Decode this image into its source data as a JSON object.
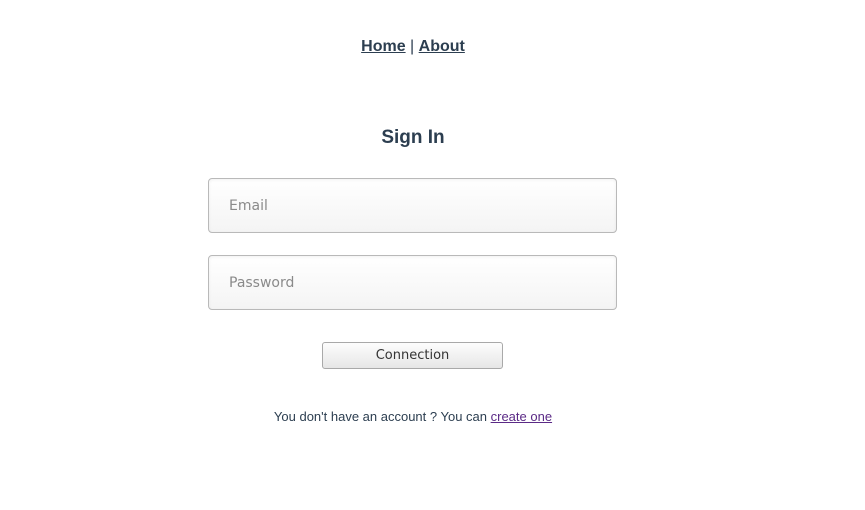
{
  "nav": {
    "home_label": "Home",
    "separator": "|",
    "about_label": "About"
  },
  "form": {
    "title": "Sign In",
    "email": {
      "placeholder": "Email",
      "value": ""
    },
    "password": {
      "placeholder": "Password",
      "value": ""
    },
    "submit_label": "Connection"
  },
  "signup": {
    "prompt": "You don't have an account ? You can",
    "link_label": "create one"
  },
  "colors": {
    "text": "#2c3e50",
    "link_visited": "#5b2a86"
  }
}
